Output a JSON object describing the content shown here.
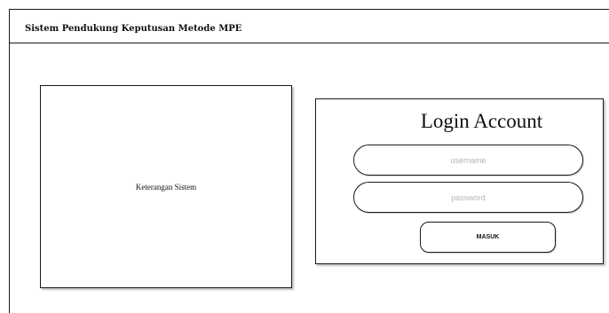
{
  "app": {
    "title": "Sistem Pendukung Keputusan Metode MPE"
  },
  "info_panel": {
    "text": "Keterangan Sistem"
  },
  "login": {
    "title": "Login Account",
    "username_placeholder": "username",
    "password_placeholder": "password",
    "submit_label": "MASUK"
  }
}
